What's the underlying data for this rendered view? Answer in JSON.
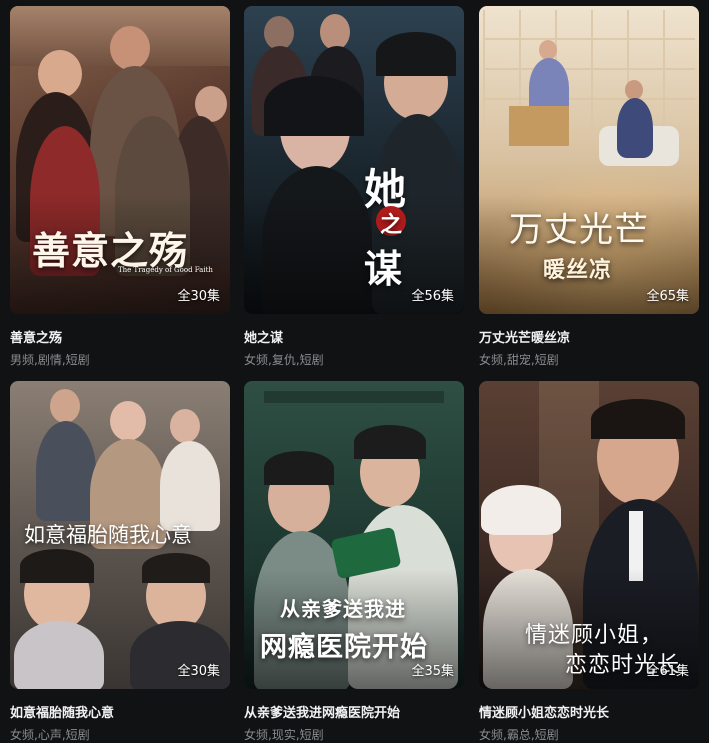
{
  "dramas": [
    {
      "title": "善意之殇",
      "tags": "男频,剧情,短剧",
      "episodes": "全30集",
      "poster_text": "善意之殇",
      "poster_sub": "The Tragedy of Good Faith",
      "bg": "#6b4a3c"
    },
    {
      "title": "她之谋",
      "tags": "女频,复仇,短剧",
      "episodes": "全56集",
      "poster_text_1": "她",
      "poster_text_2": "之",
      "poster_text_3": "谋",
      "bg": "#1e2b33"
    },
    {
      "title": "万丈光芒暖丝凉",
      "tags": "女频,甜宠,短剧",
      "episodes": "全65集",
      "poster_text": "万丈光芒",
      "poster_text_2": "暖丝凉",
      "bg": "#c9b48f"
    },
    {
      "title": "如意福胎随我心意",
      "tags": "女频,心声,短剧",
      "episodes": "全30集",
      "poster_text": "如意福胎随我心意",
      "bg": "#6f6760"
    },
    {
      "title": "从亲爹送我进网瘾医院开始",
      "tags": "女频,现实,短剧",
      "episodes": "全35集",
      "poster_text": "从亲爹送我进",
      "poster_text_2": "网瘾医院开始",
      "bg": "#213b33"
    },
    {
      "title": "情迷顾小姐恋恋时光长",
      "tags": "女频,霸总,短剧",
      "episodes": "全61集",
      "poster_text": "情迷顾小姐，",
      "poster_text_2": "恋恋时光长",
      "bg": "#3b2a26"
    }
  ]
}
